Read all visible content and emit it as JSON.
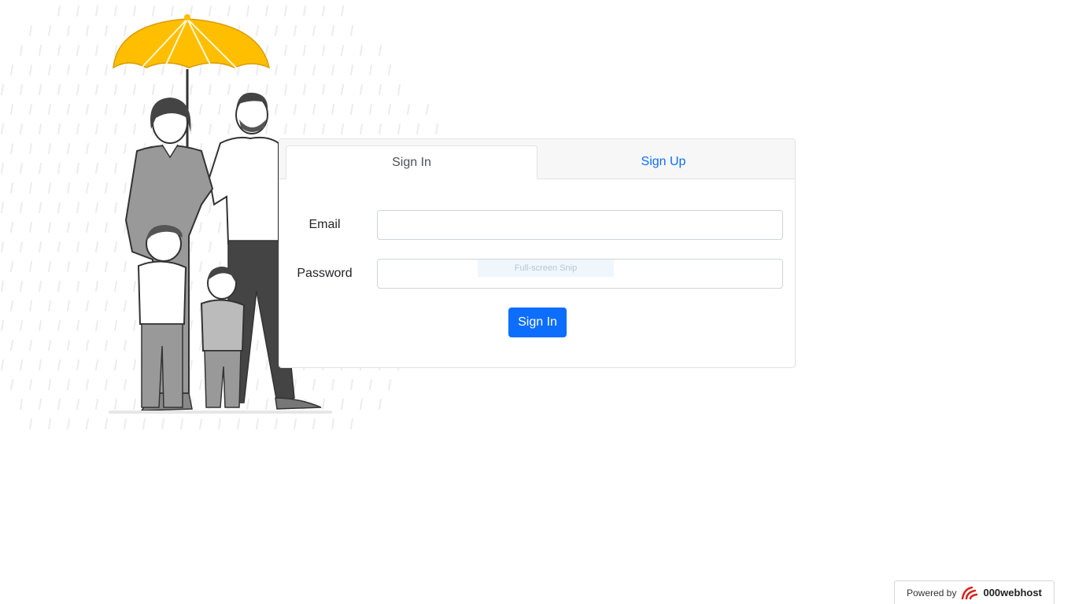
{
  "tabs": {
    "sign_in": "Sign In",
    "sign_up": "Sign Up"
  },
  "form": {
    "email_label": "Email",
    "email_value": "",
    "password_label": "Password",
    "password_value": "",
    "submit_label": "Sign In"
  },
  "overlay": {
    "snip_text": "Full-screen Snip"
  },
  "footer": {
    "powered_by": "Powered by",
    "brand": "000webhost",
    "brand_color": "#d6241c"
  },
  "colors": {
    "primary": "#0d6efd",
    "umbrella": "#ffbf00"
  }
}
